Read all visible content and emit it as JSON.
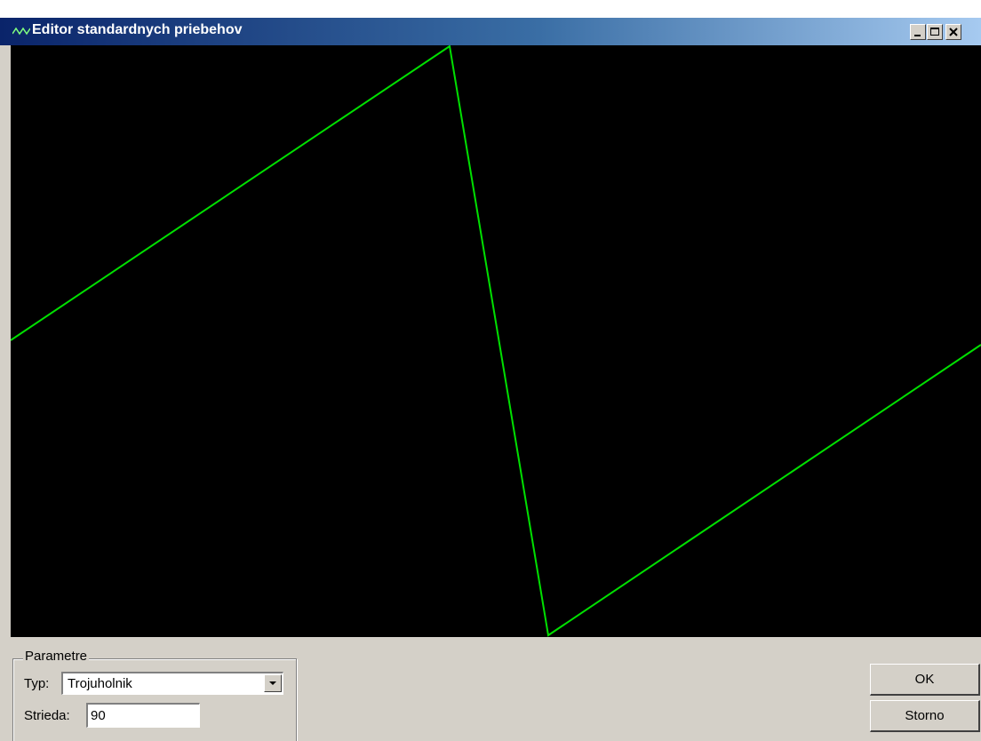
{
  "window": {
    "title": "Editor standardnych priebehov",
    "controls": [
      "minimize-icon",
      "maximize-icon",
      "close-icon"
    ]
  },
  "canvas": {
    "background": "#000000",
    "line_color": "#00e000"
  },
  "params": {
    "group_label": "Parametre",
    "type_label": "Typ:",
    "type_value": "Trojuholnik",
    "duty_label": "Strieda:",
    "duty_value": "90"
  },
  "buttons": {
    "ok": "OK",
    "cancel": "Storno"
  },
  "colors": {
    "face": "#d4d0c8",
    "titlebar_start": "#0a246a",
    "titlebar_end": "#a6caf0"
  }
}
